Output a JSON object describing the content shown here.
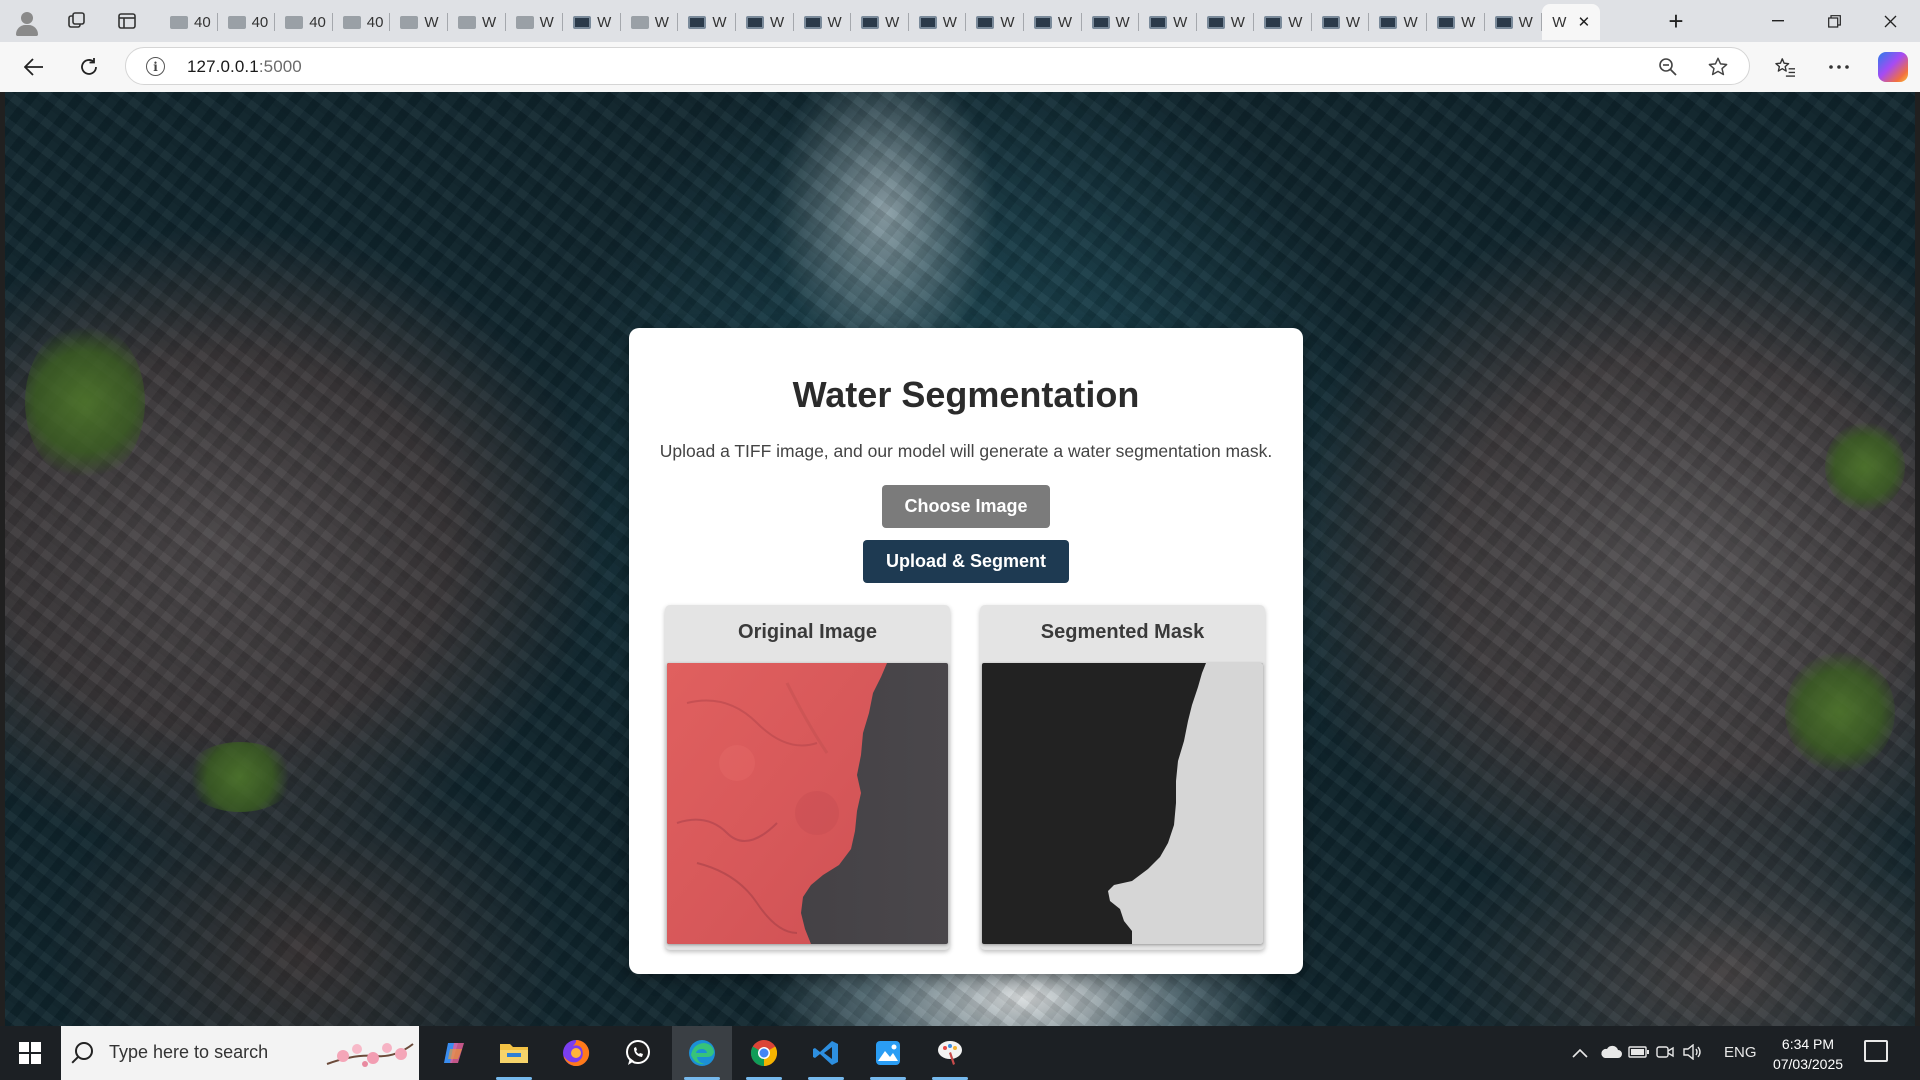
{
  "browser": {
    "tabs": [
      {
        "label": "40",
        "favicon": "grey"
      },
      {
        "label": "40",
        "favicon": "grey"
      },
      {
        "label": "40",
        "favicon": "grey"
      },
      {
        "label": "40",
        "favicon": "grey"
      },
      {
        "label": "W",
        "favicon": "grey"
      },
      {
        "label": "W",
        "favicon": "grey"
      },
      {
        "label": "W",
        "favicon": "grey"
      },
      {
        "label": "W",
        "favicon": "dark"
      },
      {
        "label": "W",
        "favicon": "grey"
      },
      {
        "label": "W",
        "favicon": "dark"
      },
      {
        "label": "W",
        "favicon": "dark"
      },
      {
        "label": "W",
        "favicon": "dark"
      },
      {
        "label": "W",
        "favicon": "dark"
      },
      {
        "label": "W",
        "favicon": "dark"
      },
      {
        "label": "W",
        "favicon": "dark"
      },
      {
        "label": "W",
        "favicon": "dark"
      },
      {
        "label": "W",
        "favicon": "dark"
      },
      {
        "label": "W",
        "favicon": "dark"
      },
      {
        "label": "W",
        "favicon": "dark"
      },
      {
        "label": "W",
        "favicon": "dark"
      },
      {
        "label": "W",
        "favicon": "dark"
      },
      {
        "label": "W",
        "favicon": "dark"
      },
      {
        "label": "W",
        "favicon": "dark"
      },
      {
        "label": "W",
        "favicon": "dark"
      }
    ],
    "active_tab": {
      "label": "W",
      "close_glyph": "✕"
    },
    "new_tab_glyph": "+",
    "address": {
      "host": "127.0.0.1",
      "port": ":5000"
    }
  },
  "page": {
    "title": "Water Segmentation",
    "description": "Upload a TIFF image, and our model will generate a water segmentation mask.",
    "choose_button": "Choose Image",
    "upload_button": "Upload & Segment",
    "original_panel_title": "Original Image",
    "mask_panel_title": "Segmented Mask"
  },
  "taskbar": {
    "search_placeholder": "Type here to search",
    "language": "ENG",
    "time": "6:34 PM",
    "date": "07/03/2025"
  },
  "colors": {
    "primary_button": "#1e3a52",
    "secondary_button": "#7b7b7b",
    "land_false_color": "#d9595c",
    "water_false_color": "#434044",
    "mask_water": "#d6d6d6",
    "mask_land": "#222222"
  },
  "icons": {
    "back": "arrow-left-icon",
    "refresh": "refresh-icon",
    "info": "info-icon",
    "zoom": "zoom-out-icon",
    "favorite": "star-icon",
    "collections": "favorites-icon",
    "more": "more-icon"
  }
}
